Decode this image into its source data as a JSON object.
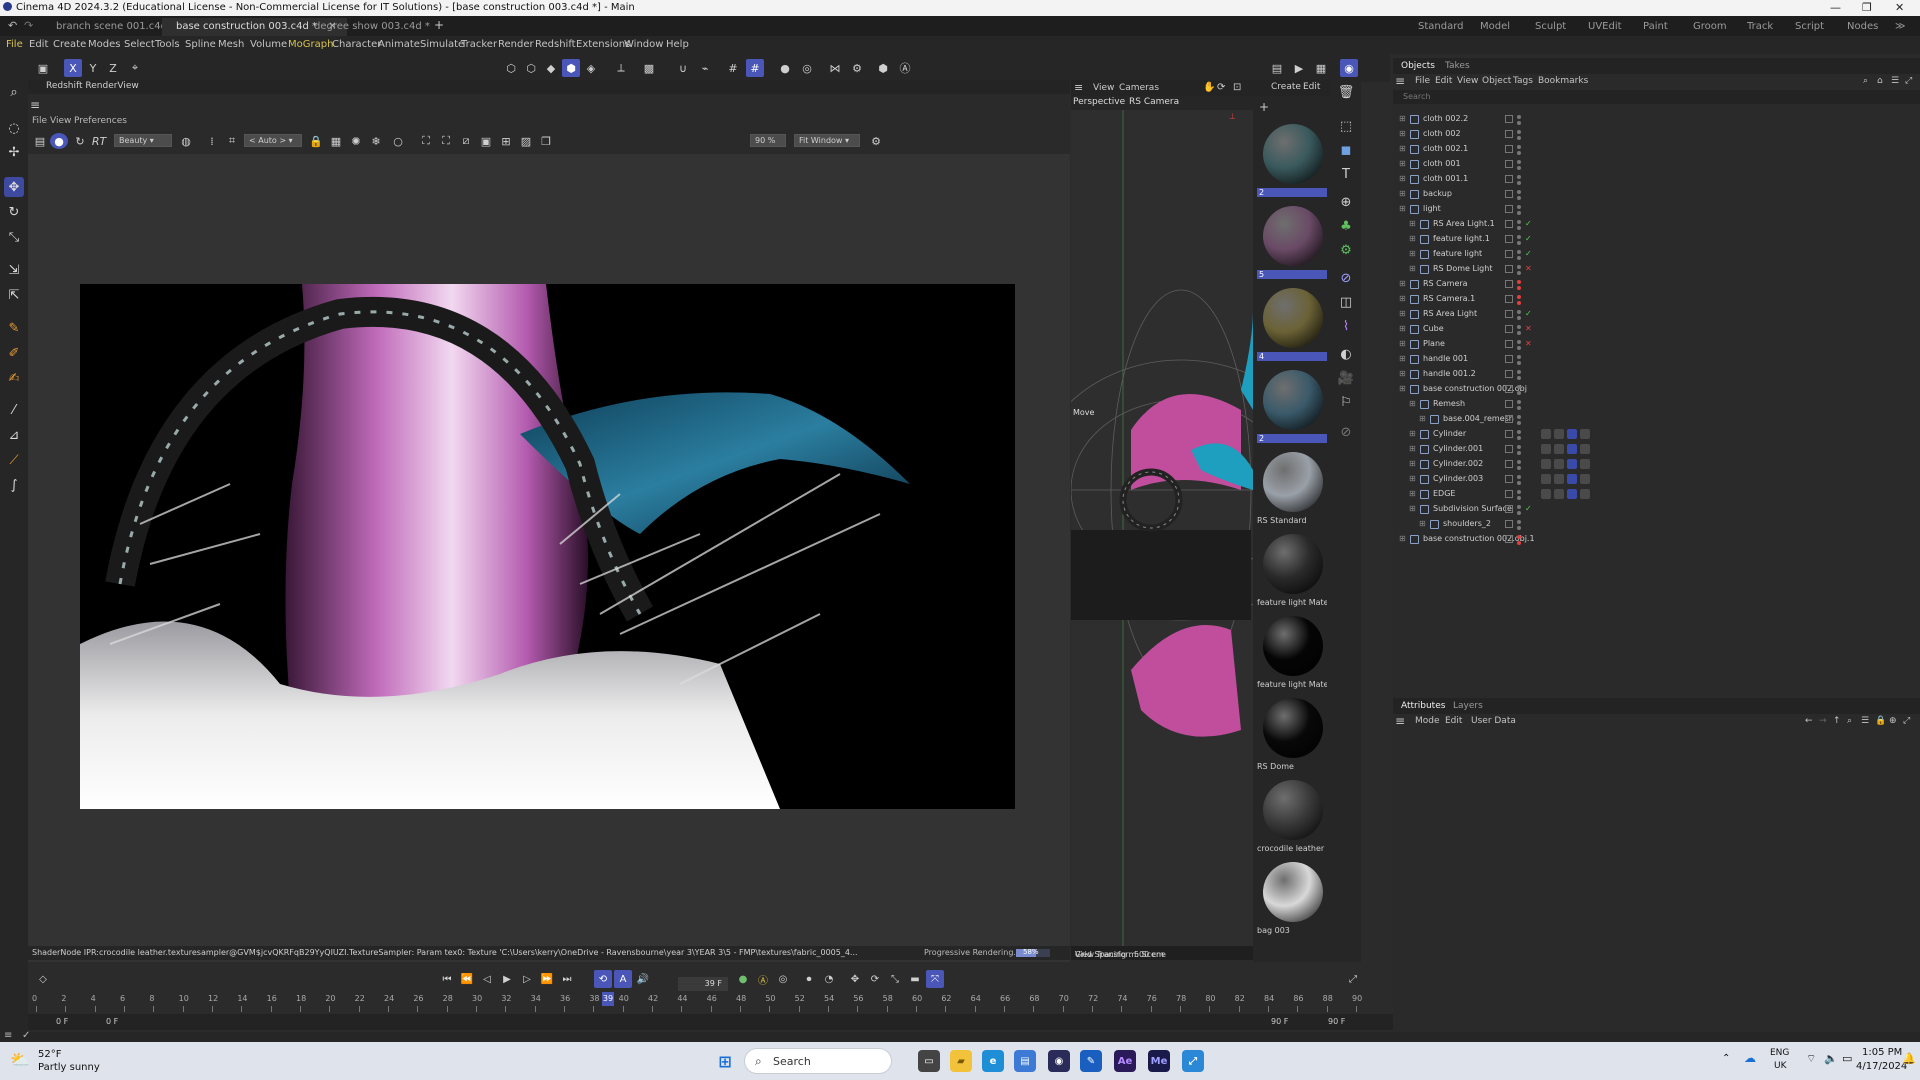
{
  "window": {
    "title": "Cinema 4D 2024.3.2 (Educational License - Non-Commercial License for IT Solutions) - [base construction 003.c4d *] - Main"
  },
  "doc_tabs": [
    "branch scene 001.c4d *",
    "base construction 003.c4d *",
    "degree show 003.c4d *"
  ],
  "layouts": [
    "Standard",
    "Model",
    "Sculpt",
    "UVEdit",
    "Paint",
    "Groom",
    "Track",
    "Script",
    "Nodes"
  ],
  "menu": [
    "File",
    "Edit",
    "Create",
    "Modes",
    "Select",
    "Tools",
    "Spline",
    "Mesh",
    "Volume",
    "MoGraph",
    "Character",
    "Animate",
    "Simulate",
    "Tracker",
    "Render",
    "Redshift",
    "Extensions",
    "Window",
    "Help"
  ],
  "axis_labels": [
    "X",
    "Y",
    "Z"
  ],
  "renderview": {
    "title": "Redshift RenderView",
    "menu": [
      "File",
      "View",
      "Preferences"
    ],
    "rt_label": "RT",
    "aov": "Beauty",
    "camera_mode": "< Auto >",
    "zoom": "90 %",
    "fit": "Fit Window",
    "status_text": "ShaderNode IPR:crocodile leather.texturesampler@GVM$jcvQKRFqB29YyQIUZI.TextureSampler: Param tex0: Texture 'C:\\Users\\kerry\\OneDrive - Ravensbourne\\year 3\\YEAR 3\\5 - FMP\\textures\\fabric_0005_4...",
    "progress_label": "Progressive Rendering...",
    "progress_value": "58%",
    "progress_fraction": 0.58
  },
  "viewport": {
    "menu": [
      "View",
      "Cameras"
    ],
    "view_name": "Perspective",
    "camera": "RS Camera",
    "move_label": "Move",
    "status": "View Transform: Scene",
    "grid_spacing": "Grid Spacing : 500 cm"
  },
  "materials": {
    "menu": [
      "Create",
      "Edit"
    ],
    "items": [
      {
        "label": "2",
        "color": "#3a5a5e",
        "numbered": true
      },
      {
        "label": "5",
        "color": "#6a4a66",
        "numbered": true
      },
      {
        "label": "4",
        "color": "#6b6236",
        "numbered": true
      },
      {
        "label": "2",
        "color": "#3a5a6a",
        "numbered": true
      },
      {
        "label": "RS Standard",
        "color": "#9aa0a8",
        "numbered": false
      },
      {
        "label": "feature light Mate",
        "color": "#2a2a2a",
        "numbered": false
      },
      {
        "label": "feature light Mate",
        "color": "#050505",
        "numbered": false
      },
      {
        "label": "RS Dome",
        "color": "#080808",
        "numbered": false
      },
      {
        "label": "crocodile leather",
        "color": "#3a3a3a",
        "numbered": false
      },
      {
        "label": "bag 003",
        "color": "#d8d8d8",
        "numbered": false
      }
    ]
  },
  "objects_panel": {
    "tabs": [
      "Objects",
      "Takes"
    ],
    "menu": [
      "File",
      "Edit",
      "View",
      "Object",
      "Tags",
      "Bookmarks"
    ],
    "search_placeholder": "Search",
    "rows": [
      {
        "name": "cloth 002.2",
        "depth": 0,
        "status": "gray"
      },
      {
        "name": "cloth 002",
        "depth": 0,
        "status": "gray"
      },
      {
        "name": "cloth 002.1",
        "depth": 0,
        "status": "gray"
      },
      {
        "name": "cloth 001",
        "depth": 0,
        "status": "gray"
      },
      {
        "name": "cloth 001.1",
        "depth": 0,
        "status": "gray"
      },
      {
        "name": "backup",
        "depth": 0,
        "status": "gray"
      },
      {
        "name": "light",
        "depth": 0,
        "status": "gray"
      },
      {
        "name": "RS Area Light.1",
        "depth": 1,
        "status": "check"
      },
      {
        "name": "feature light.1",
        "depth": 1,
        "status": "check"
      },
      {
        "name": "feature light",
        "depth": 1,
        "status": "check"
      },
      {
        "name": "RS Dome Light",
        "depth": 1,
        "status": "cross"
      },
      {
        "name": "RS Camera",
        "depth": 0,
        "status": "red"
      },
      {
        "name": "RS Camera.1",
        "depth": 0,
        "status": "red"
      },
      {
        "name": "RS Area Light",
        "depth": 0,
        "status": "check"
      },
      {
        "name": "Cube",
        "depth": 0,
        "status": "cross"
      },
      {
        "name": "Plane",
        "depth": 0,
        "status": "cross"
      },
      {
        "name": "handle 001",
        "depth": 0,
        "status": "gray"
      },
      {
        "name": "handle 001.2",
        "depth": 0,
        "status": "gray"
      },
      {
        "name": "base construction 002.obj",
        "depth": 0,
        "status": "gray"
      },
      {
        "name": "Remesh",
        "depth": 1,
        "status": "gray"
      },
      {
        "name": "base.004_remesh",
        "depth": 2,
        "status": "gray"
      },
      {
        "name": "Cylinder",
        "depth": 1,
        "status": "gray"
      },
      {
        "name": "Cylinder.001",
        "depth": 1,
        "status": "gray"
      },
      {
        "name": "Cylinder.002",
        "depth": 1,
        "status": "gray"
      },
      {
        "name": "Cylinder.003",
        "depth": 1,
        "status": "gray"
      },
      {
        "name": "EDGE",
        "depth": 1,
        "status": "gray"
      },
      {
        "name": "Subdivision Surface",
        "depth": 1,
        "status": "check"
      },
      {
        "name": "shoulders_2",
        "depth": 2,
        "status": "gray"
      },
      {
        "name": "base construction 002.obj.1",
        "depth": 0,
        "status": "red"
      }
    ]
  },
  "attributes_panel": {
    "tabs": [
      "Attributes",
      "Layers"
    ],
    "menu": [
      "Mode",
      "Edit",
      "User Data"
    ]
  },
  "timeline": {
    "current_frame": "39 F",
    "start": "0 F",
    "start2": "0 F",
    "end": "90 F",
    "end2": "90 F",
    "ticks": [
      "0",
      "2",
      "4",
      "6",
      "8",
      "10",
      "12",
      "14",
      "16",
      "18",
      "20",
      "22",
      "24",
      "26",
      "28",
      "30",
      "32",
      "34",
      "36",
      "38",
      "40",
      "42",
      "44",
      "46",
      "48",
      "50",
      "52",
      "54",
      "56",
      "58",
      "60",
      "62",
      "64",
      "66",
      "68",
      "70",
      "72",
      "74",
      "76",
      "78",
      "80",
      "82",
      "84",
      "86",
      "88",
      "90"
    ],
    "playhead_label": "39"
  },
  "taskbar": {
    "weather_temp": "52°F",
    "weather_desc": "Partly sunny",
    "search_label": "Search",
    "lang1": "ENG",
    "lang2": "UK",
    "time": "1:05 PM",
    "date": "4/17/2024"
  }
}
